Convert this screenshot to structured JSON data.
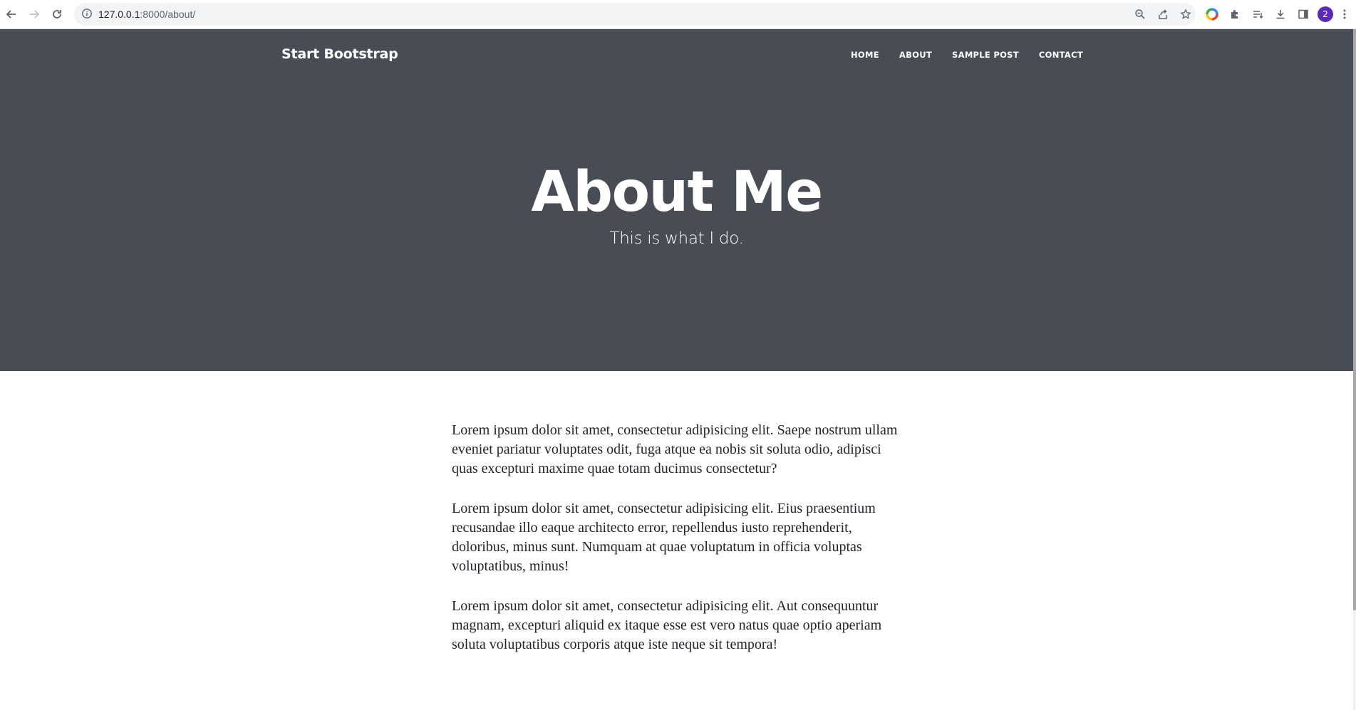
{
  "browser": {
    "url_host": "127.0.0.1",
    "url_rest": ":8000/about/",
    "profile_initial": "2",
    "icons": {
      "back": "back-arrow-icon",
      "forward": "forward-arrow-icon",
      "reload": "reload-icon",
      "site_info": "info-icon",
      "zoom": "zoom-icon",
      "share": "share-icon",
      "bookmark": "star-icon",
      "color_ext": "color-wheel-icon",
      "extensions": "puzzle-icon",
      "reading_list": "reading-list-icon",
      "downloads": "download-icon",
      "side_panel": "side-panel-icon",
      "menu": "kebab-menu-icon"
    }
  },
  "navbar": {
    "brand": "Start Bootstrap",
    "items": [
      {
        "label": "Home"
      },
      {
        "label": "About"
      },
      {
        "label": "Sample Post"
      },
      {
        "label": "Contact"
      }
    ]
  },
  "header": {
    "title": "About Me",
    "subtitle": "This is what I do."
  },
  "content": {
    "paragraphs": [
      "Lorem ipsum dolor sit amet, consectetur adipisicing elit. Saepe nostrum ullam eveniet pariatur voluptates odit, fuga atque ea nobis sit soluta odio, adipisci quas excepturi maxime quae totam ducimus consectetur?",
      "Lorem ipsum dolor sit amet, consectetur adipisicing elit. Eius praesentium recusandae illo eaque architecto error, repellendus iusto reprehenderit, doloribus, minus sunt. Numquam at quae voluptatum in officia voluptas voluptatibus, minus!",
      "Lorem ipsum dolor sit amet, consectetur adipisicing elit. Aut consequuntur magnam, excepturi aliquid ex itaque esse est vero natus quae optio aperiam soluta voluptatibus corporis atque iste neque sit tempora!"
    ]
  },
  "colors": {
    "header_bg": "#484d55",
    "text": "#212529",
    "avatar": "#5b2bb5"
  }
}
